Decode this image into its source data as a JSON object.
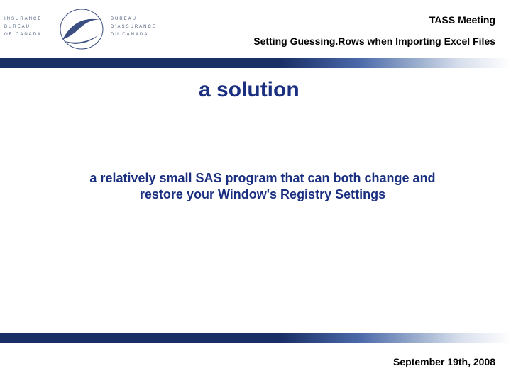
{
  "header": {
    "logo_left_line1": "INSURANCE",
    "logo_left_line2": "BUREAU",
    "logo_left_line3": "OF CANADA",
    "logo_right_line1": "BUREAU",
    "logo_right_line2": "D'ASSURANCE",
    "logo_right_line3": "DU CANADA",
    "meeting": "TASS Meeting",
    "subtitle": "Setting Guessing.Rows when Importing Excel Files"
  },
  "slide": {
    "title": "a solution",
    "body": "a relatively small SAS program that can both change and restore your Window's Registry Settings"
  },
  "footer": {
    "date": "September 19th, 2008"
  }
}
